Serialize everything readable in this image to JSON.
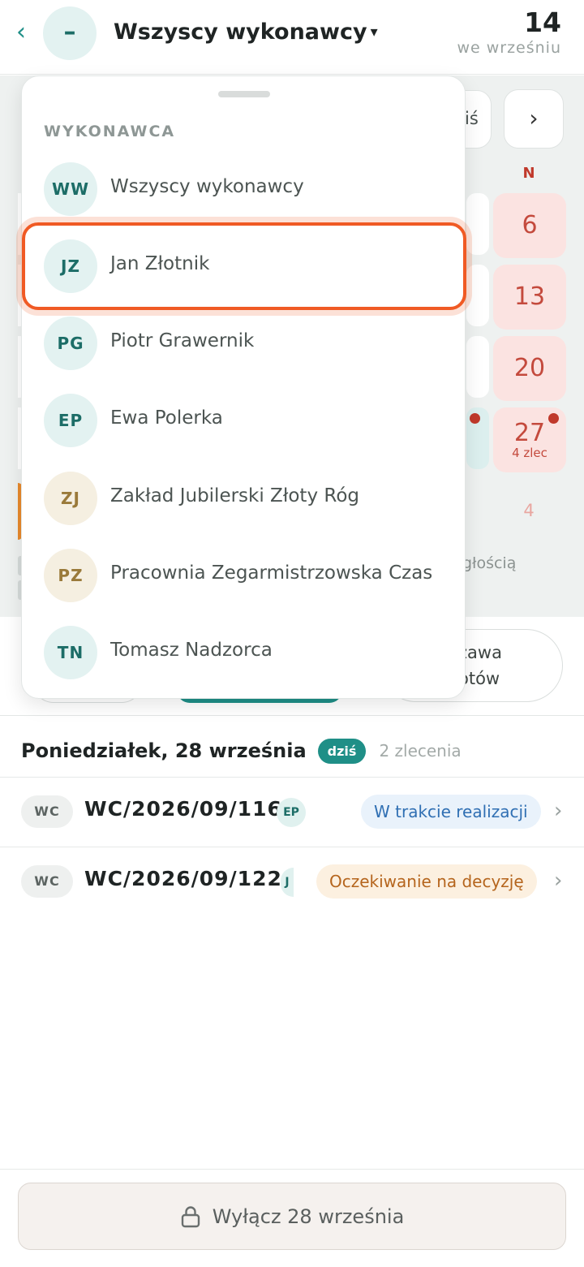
{
  "header": {
    "title": "Wszyscy wykonawcy",
    "caret": "▾",
    "back_icon": "‹",
    "collapse_icon": "–",
    "count": "14",
    "count_label": "we wrześniu"
  },
  "calendar": {
    "today_label": "Dziś",
    "today_label_visible": "iś",
    "next_icon": "›",
    "weekday": "N",
    "days": [
      {
        "label": "6"
      },
      {
        "label": "13"
      },
      {
        "label": "20"
      },
      {
        "label": "27",
        "sub": "4 zlec"
      }
    ],
    "faded_day": "4",
    "legend_fragment": "głością"
  },
  "filters": {
    "right_chip_line1": "zawa",
    "right_chip_line2": "otów"
  },
  "dropdown": {
    "heading": "WYKONAWCA",
    "options": [
      {
        "initials": "WW",
        "name": "Wszyscy wykonawcy",
        "tone": "teal"
      },
      {
        "initials": "JZ",
        "name": "Jan Złotnik",
        "tone": "teal",
        "highlighted": true
      },
      {
        "initials": "PG",
        "name": "Piotr Grawernik",
        "tone": "teal"
      },
      {
        "initials": "EP",
        "name": "Ewa Polerka",
        "tone": "teal"
      },
      {
        "initials": "ZJ",
        "name": "Zakład Jubilerski Złoty Róg",
        "tone": "sand"
      },
      {
        "initials": "PZ",
        "name": "Pracownia Zegarmistrzowska Czas",
        "tone": "sand"
      },
      {
        "initials": "TN",
        "name": "Tomasz Nadzorca",
        "tone": "teal"
      }
    ]
  },
  "day_section": {
    "title": "Poniedziałek, 28 września",
    "today_badge": "dziś",
    "order_count": "2 zlecenia"
  },
  "orders": [
    {
      "tag": "WC",
      "id": "WC/2026/09/116",
      "assignee": "EP",
      "status": "W trakcie realizacji",
      "status_color": "#2f6fb3"
    },
    {
      "tag": "WC",
      "id": "WC/2026/09/122",
      "assignee": "J",
      "status": "Oczekiwanie na decyzję",
      "status_color": "#b5651d"
    }
  ],
  "bottom": {
    "button_label": "Wyłącz 28 września",
    "icon": "lock-icon"
  },
  "colors": {
    "accent": "#1f8f87",
    "highlight": "#f05a24",
    "weekend": "#c0392b"
  }
}
